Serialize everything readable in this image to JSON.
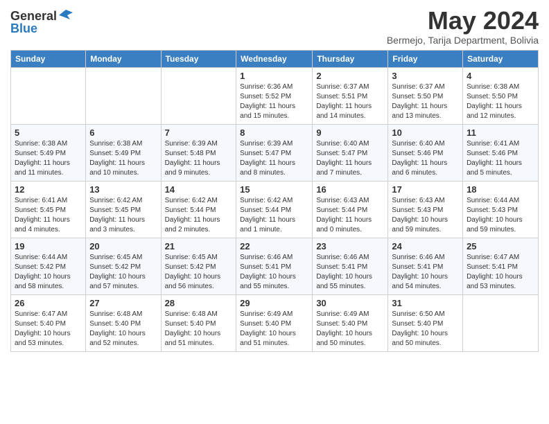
{
  "header": {
    "logo_general": "General",
    "logo_blue": "Blue",
    "title": "May 2024",
    "location": "Bermejo, Tarija Department, Bolivia"
  },
  "weekdays": [
    "Sunday",
    "Monday",
    "Tuesday",
    "Wednesday",
    "Thursday",
    "Friday",
    "Saturday"
  ],
  "weeks": [
    [
      {
        "day": "",
        "info": ""
      },
      {
        "day": "",
        "info": ""
      },
      {
        "day": "",
        "info": ""
      },
      {
        "day": "1",
        "info": "Sunrise: 6:36 AM\nSunset: 5:52 PM\nDaylight: 11 hours and 15 minutes."
      },
      {
        "day": "2",
        "info": "Sunrise: 6:37 AM\nSunset: 5:51 PM\nDaylight: 11 hours and 14 minutes."
      },
      {
        "day": "3",
        "info": "Sunrise: 6:37 AM\nSunset: 5:50 PM\nDaylight: 11 hours and 13 minutes."
      },
      {
        "day": "4",
        "info": "Sunrise: 6:38 AM\nSunset: 5:50 PM\nDaylight: 11 hours and 12 minutes."
      }
    ],
    [
      {
        "day": "5",
        "info": "Sunrise: 6:38 AM\nSunset: 5:49 PM\nDaylight: 11 hours and 11 minutes."
      },
      {
        "day": "6",
        "info": "Sunrise: 6:38 AM\nSunset: 5:49 PM\nDaylight: 11 hours and 10 minutes."
      },
      {
        "day": "7",
        "info": "Sunrise: 6:39 AM\nSunset: 5:48 PM\nDaylight: 11 hours and 9 minutes."
      },
      {
        "day": "8",
        "info": "Sunrise: 6:39 AM\nSunset: 5:47 PM\nDaylight: 11 hours and 8 minutes."
      },
      {
        "day": "9",
        "info": "Sunrise: 6:40 AM\nSunset: 5:47 PM\nDaylight: 11 hours and 7 minutes."
      },
      {
        "day": "10",
        "info": "Sunrise: 6:40 AM\nSunset: 5:46 PM\nDaylight: 11 hours and 6 minutes."
      },
      {
        "day": "11",
        "info": "Sunrise: 6:41 AM\nSunset: 5:46 PM\nDaylight: 11 hours and 5 minutes."
      }
    ],
    [
      {
        "day": "12",
        "info": "Sunrise: 6:41 AM\nSunset: 5:45 PM\nDaylight: 11 hours and 4 minutes."
      },
      {
        "day": "13",
        "info": "Sunrise: 6:42 AM\nSunset: 5:45 PM\nDaylight: 11 hours and 3 minutes."
      },
      {
        "day": "14",
        "info": "Sunrise: 6:42 AM\nSunset: 5:44 PM\nDaylight: 11 hours and 2 minutes."
      },
      {
        "day": "15",
        "info": "Sunrise: 6:42 AM\nSunset: 5:44 PM\nDaylight: 11 hours and 1 minute."
      },
      {
        "day": "16",
        "info": "Sunrise: 6:43 AM\nSunset: 5:44 PM\nDaylight: 11 hours and 0 minutes."
      },
      {
        "day": "17",
        "info": "Sunrise: 6:43 AM\nSunset: 5:43 PM\nDaylight: 10 hours and 59 minutes."
      },
      {
        "day": "18",
        "info": "Sunrise: 6:44 AM\nSunset: 5:43 PM\nDaylight: 10 hours and 59 minutes."
      }
    ],
    [
      {
        "day": "19",
        "info": "Sunrise: 6:44 AM\nSunset: 5:42 PM\nDaylight: 10 hours and 58 minutes."
      },
      {
        "day": "20",
        "info": "Sunrise: 6:45 AM\nSunset: 5:42 PM\nDaylight: 10 hours and 57 minutes."
      },
      {
        "day": "21",
        "info": "Sunrise: 6:45 AM\nSunset: 5:42 PM\nDaylight: 10 hours and 56 minutes."
      },
      {
        "day": "22",
        "info": "Sunrise: 6:46 AM\nSunset: 5:41 PM\nDaylight: 10 hours and 55 minutes."
      },
      {
        "day": "23",
        "info": "Sunrise: 6:46 AM\nSunset: 5:41 PM\nDaylight: 10 hours and 55 minutes."
      },
      {
        "day": "24",
        "info": "Sunrise: 6:46 AM\nSunset: 5:41 PM\nDaylight: 10 hours and 54 minutes."
      },
      {
        "day": "25",
        "info": "Sunrise: 6:47 AM\nSunset: 5:41 PM\nDaylight: 10 hours and 53 minutes."
      }
    ],
    [
      {
        "day": "26",
        "info": "Sunrise: 6:47 AM\nSunset: 5:40 PM\nDaylight: 10 hours and 53 minutes."
      },
      {
        "day": "27",
        "info": "Sunrise: 6:48 AM\nSunset: 5:40 PM\nDaylight: 10 hours and 52 minutes."
      },
      {
        "day": "28",
        "info": "Sunrise: 6:48 AM\nSunset: 5:40 PM\nDaylight: 10 hours and 51 minutes."
      },
      {
        "day": "29",
        "info": "Sunrise: 6:49 AM\nSunset: 5:40 PM\nDaylight: 10 hours and 51 minutes."
      },
      {
        "day": "30",
        "info": "Sunrise: 6:49 AM\nSunset: 5:40 PM\nDaylight: 10 hours and 50 minutes."
      },
      {
        "day": "31",
        "info": "Sunrise: 6:50 AM\nSunset: 5:40 PM\nDaylight: 10 hours and 50 minutes."
      },
      {
        "day": "",
        "info": ""
      }
    ]
  ]
}
